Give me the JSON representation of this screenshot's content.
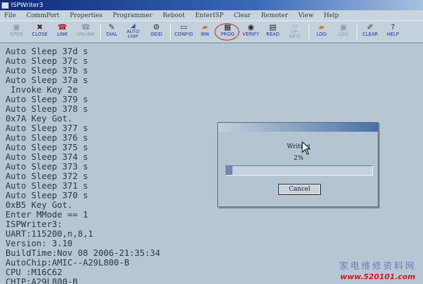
{
  "window": {
    "title": "ISPWriter3"
  },
  "menu": [
    {
      "label": "File",
      "dim": false
    },
    {
      "label": "CommPort",
      "dim": false
    },
    {
      "label": "Properties",
      "dim": false
    },
    {
      "label": "Programmer",
      "dim": false
    },
    {
      "label": "Reboot",
      "dim": false
    },
    {
      "label": "EnterISP",
      "dim": false
    },
    {
      "label": "Clear",
      "dim": false
    },
    {
      "label": "Remoter",
      "dim": false
    },
    {
      "label": "View",
      "dim": false
    },
    {
      "label": "Help",
      "dim": false
    }
  ],
  "toolbar": {
    "open": "OPEN",
    "close": "CLOSE",
    "link": "LINK",
    "unlink": "UNLINK",
    "dial": "DIAL",
    "auto_chip_1": "AUTO",
    "auto_chip_2": "CHIP",
    "geid": "GEID",
    "config": "CONFIG",
    "bin": "BIN",
    "prog": "PROG",
    "verify": "VERIFY",
    "read": "READ",
    "update_1": "UP-",
    "update_2": "DATE",
    "log": "LOG",
    "log2": "LOG",
    "clear": "CLEAR",
    "help": "HELP"
  },
  "console_lines": [
    "Auto Sleep 37d s",
    "Auto Sleep 37c s",
    "Auto Sleep 37b s",
    "Auto Sleep 37a s",
    " Invoke Key 2e",
    "Auto Sleep 379 s",
    "Auto Sleep 378 s",
    "0x7A Key Got.",
    "Auto Sleep 377 s",
    "Auto Sleep 376 s",
    "Auto Sleep 375 s",
    "Auto Sleep 374 s",
    "Auto Sleep 373 s",
    "Auto Sleep 372 s",
    "Auto Sleep 371 s",
    "Auto Sleep 370 s",
    "0xB5 Key Got.",
    "Enter MMode == 1",
    "ISPWriter3:",
    "UART:115200,n,8,1",
    "Version: 3.10",
    "BuildTime:Nov 08 2006-21:35:34",
    "AutoChip:AMIC--A29L800-B",
    "CPU :M16C62",
    "CHIP:A29L800-B"
  ],
  "dialog": {
    "status": "Writing",
    "percent_text": "2%",
    "progress": 0.04,
    "cancel_label": "Cancel"
  },
  "watermark": {
    "text": "家电维修资料网",
    "url": "www.520101.com"
  }
}
